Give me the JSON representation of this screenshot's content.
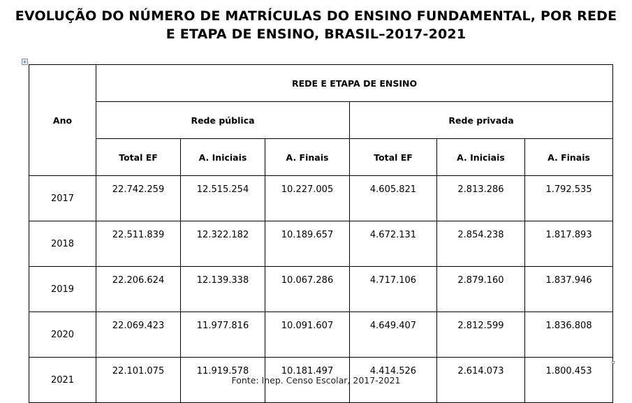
{
  "title": "EVOLUÇÃO DO NÚMERO DE MATRÍCULAS DO ENSINO FUNDAMENTAL, POR REDE E ETAPA DE ENSINO, BRASIL–2017-2021",
  "table": {
    "row_header": "Ano",
    "group_header": "REDE E ETAPA DE ENSINO",
    "networks": [
      {
        "label": "Rede pública",
        "columns": [
          "Total EF",
          "A. Iniciais",
          "A. Finais"
        ]
      },
      {
        "label": "Rede privada",
        "columns": [
          "Total EF",
          "A. Iniciais",
          "A. Finais"
        ]
      }
    ],
    "rows": [
      {
        "year": "2017",
        "values": [
          "22.742.259",
          "12.515.254",
          "10.227.005",
          "4.605.821",
          "2.813.286",
          "1.792.535"
        ]
      },
      {
        "year": "2018",
        "values": [
          "22.511.839",
          "12.322.182",
          "10.189.657",
          "4.672.131",
          "2.854.238",
          "1.817.893"
        ]
      },
      {
        "year": "2019",
        "values": [
          "22.206.624",
          "12.139.338",
          "10.067.286",
          "4.717.106",
          "2.879.160",
          "1.837.946"
        ]
      },
      {
        "year": "2020",
        "values": [
          "22.069.423",
          "11.977.816",
          "10.091.607",
          "4.649.407",
          "2.812.599",
          "1.836.808"
        ]
      },
      {
        "year": "2021",
        "values": [
          "22.101.075",
          "11.919.578",
          "10.181.497",
          "4.414.526",
          "2.614.073",
          "1.800.453"
        ]
      }
    ]
  },
  "source": "Fonte: Inep. Censo Escolar, 2017-2021",
  "anchor_glyph": "+"
}
